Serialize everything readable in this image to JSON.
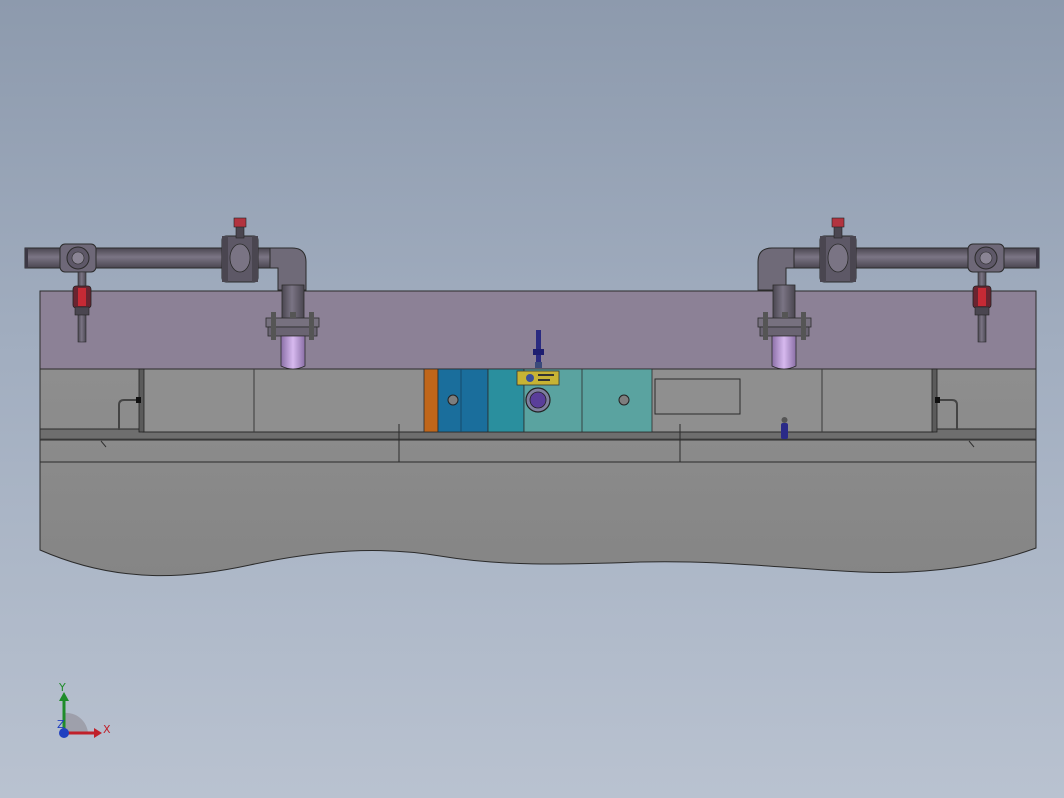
{
  "colors": {
    "background_top": "#8d9aad",
    "background_bottom": "#b9c2d0",
    "panel": "#8c8196",
    "body": "#8f8f8f",
    "pipe": "#5f5a66",
    "orange_plate": "#c0661a",
    "blue_plate": "#1a6e9c",
    "teal_plate": "#2a8f9e",
    "sea_plate": "#5aa3a0",
    "axis_x": "#c0202a",
    "axis_y": "#1f8c2a",
    "axis_z": "#2040c0"
  },
  "triad": {
    "x_label": "X",
    "y_label": "Y",
    "z_label": "Z"
  }
}
